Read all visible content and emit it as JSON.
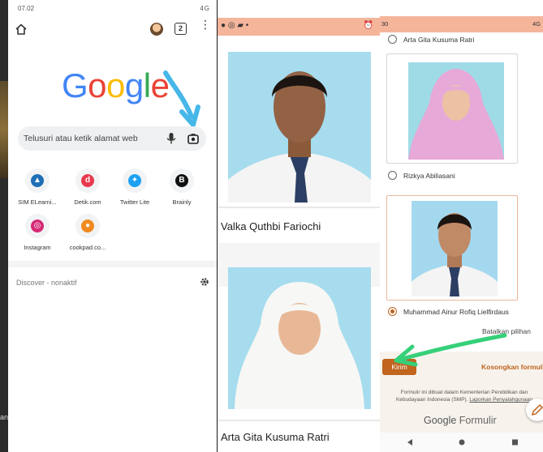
{
  "panel1": {
    "status": {
      "time": "07.02",
      "right": "4G"
    },
    "toolbar": {
      "tab_count": "2"
    },
    "logo_text": "Google",
    "logo_colors": [
      "#4285F4",
      "#EA4335",
      "#FBBC05",
      "#4285F4",
      "#34A853",
      "#EA4335"
    ],
    "search": {
      "placeholder": "Telusuri atau ketik alamat web"
    },
    "shortcuts": [
      {
        "label": "SIM ELearni...",
        "icon": "sim-elearning-icon",
        "color": "#1f6fb5"
      },
      {
        "label": "Detik.com",
        "icon": "detik-icon",
        "color": "#e83a4e"
      },
      {
        "label": "Twitter Lite",
        "icon": "twitter-icon",
        "color": "#1da1f2"
      },
      {
        "label": "Brainly",
        "icon": "brainly-icon",
        "color": "#111111"
      },
      {
        "label": "Instagram",
        "icon": "instagram-icon",
        "color": "#d62976"
      },
      {
        "label": "cookpad.co...",
        "icon": "cookpad-icon",
        "color": "#f18a1f"
      }
    ],
    "discover": "Discover - nonaktif"
  },
  "panel2": {
    "names": [
      "Valka Quthbi Fariochi",
      "Arta Gita Kusuma Ratri"
    ]
  },
  "panel3": {
    "status": {
      "left": "30",
      "right": "4G"
    },
    "options": [
      "Arta Gita Kusuma Ratri",
      "Rizkya Abiliasani",
      "Muhammad Ainur Rofiq Lielfirdaus"
    ],
    "clear_choice": "Batalkan pilihan",
    "submit": "Kirim",
    "clear_form": "Kosongkan formulir",
    "footer_line1": "Formulir ini dibuat dalam Kementerian Pendidikan dan",
    "footer_line2": "Kebudayaan Indonesia (SMP).",
    "footer_link": "Laporkan Penyalahgunaan",
    "brand_google": "Google",
    "brand_forms": "Formulir",
    "accent": "#c0641e",
    "header_color": "#f4b59b"
  }
}
